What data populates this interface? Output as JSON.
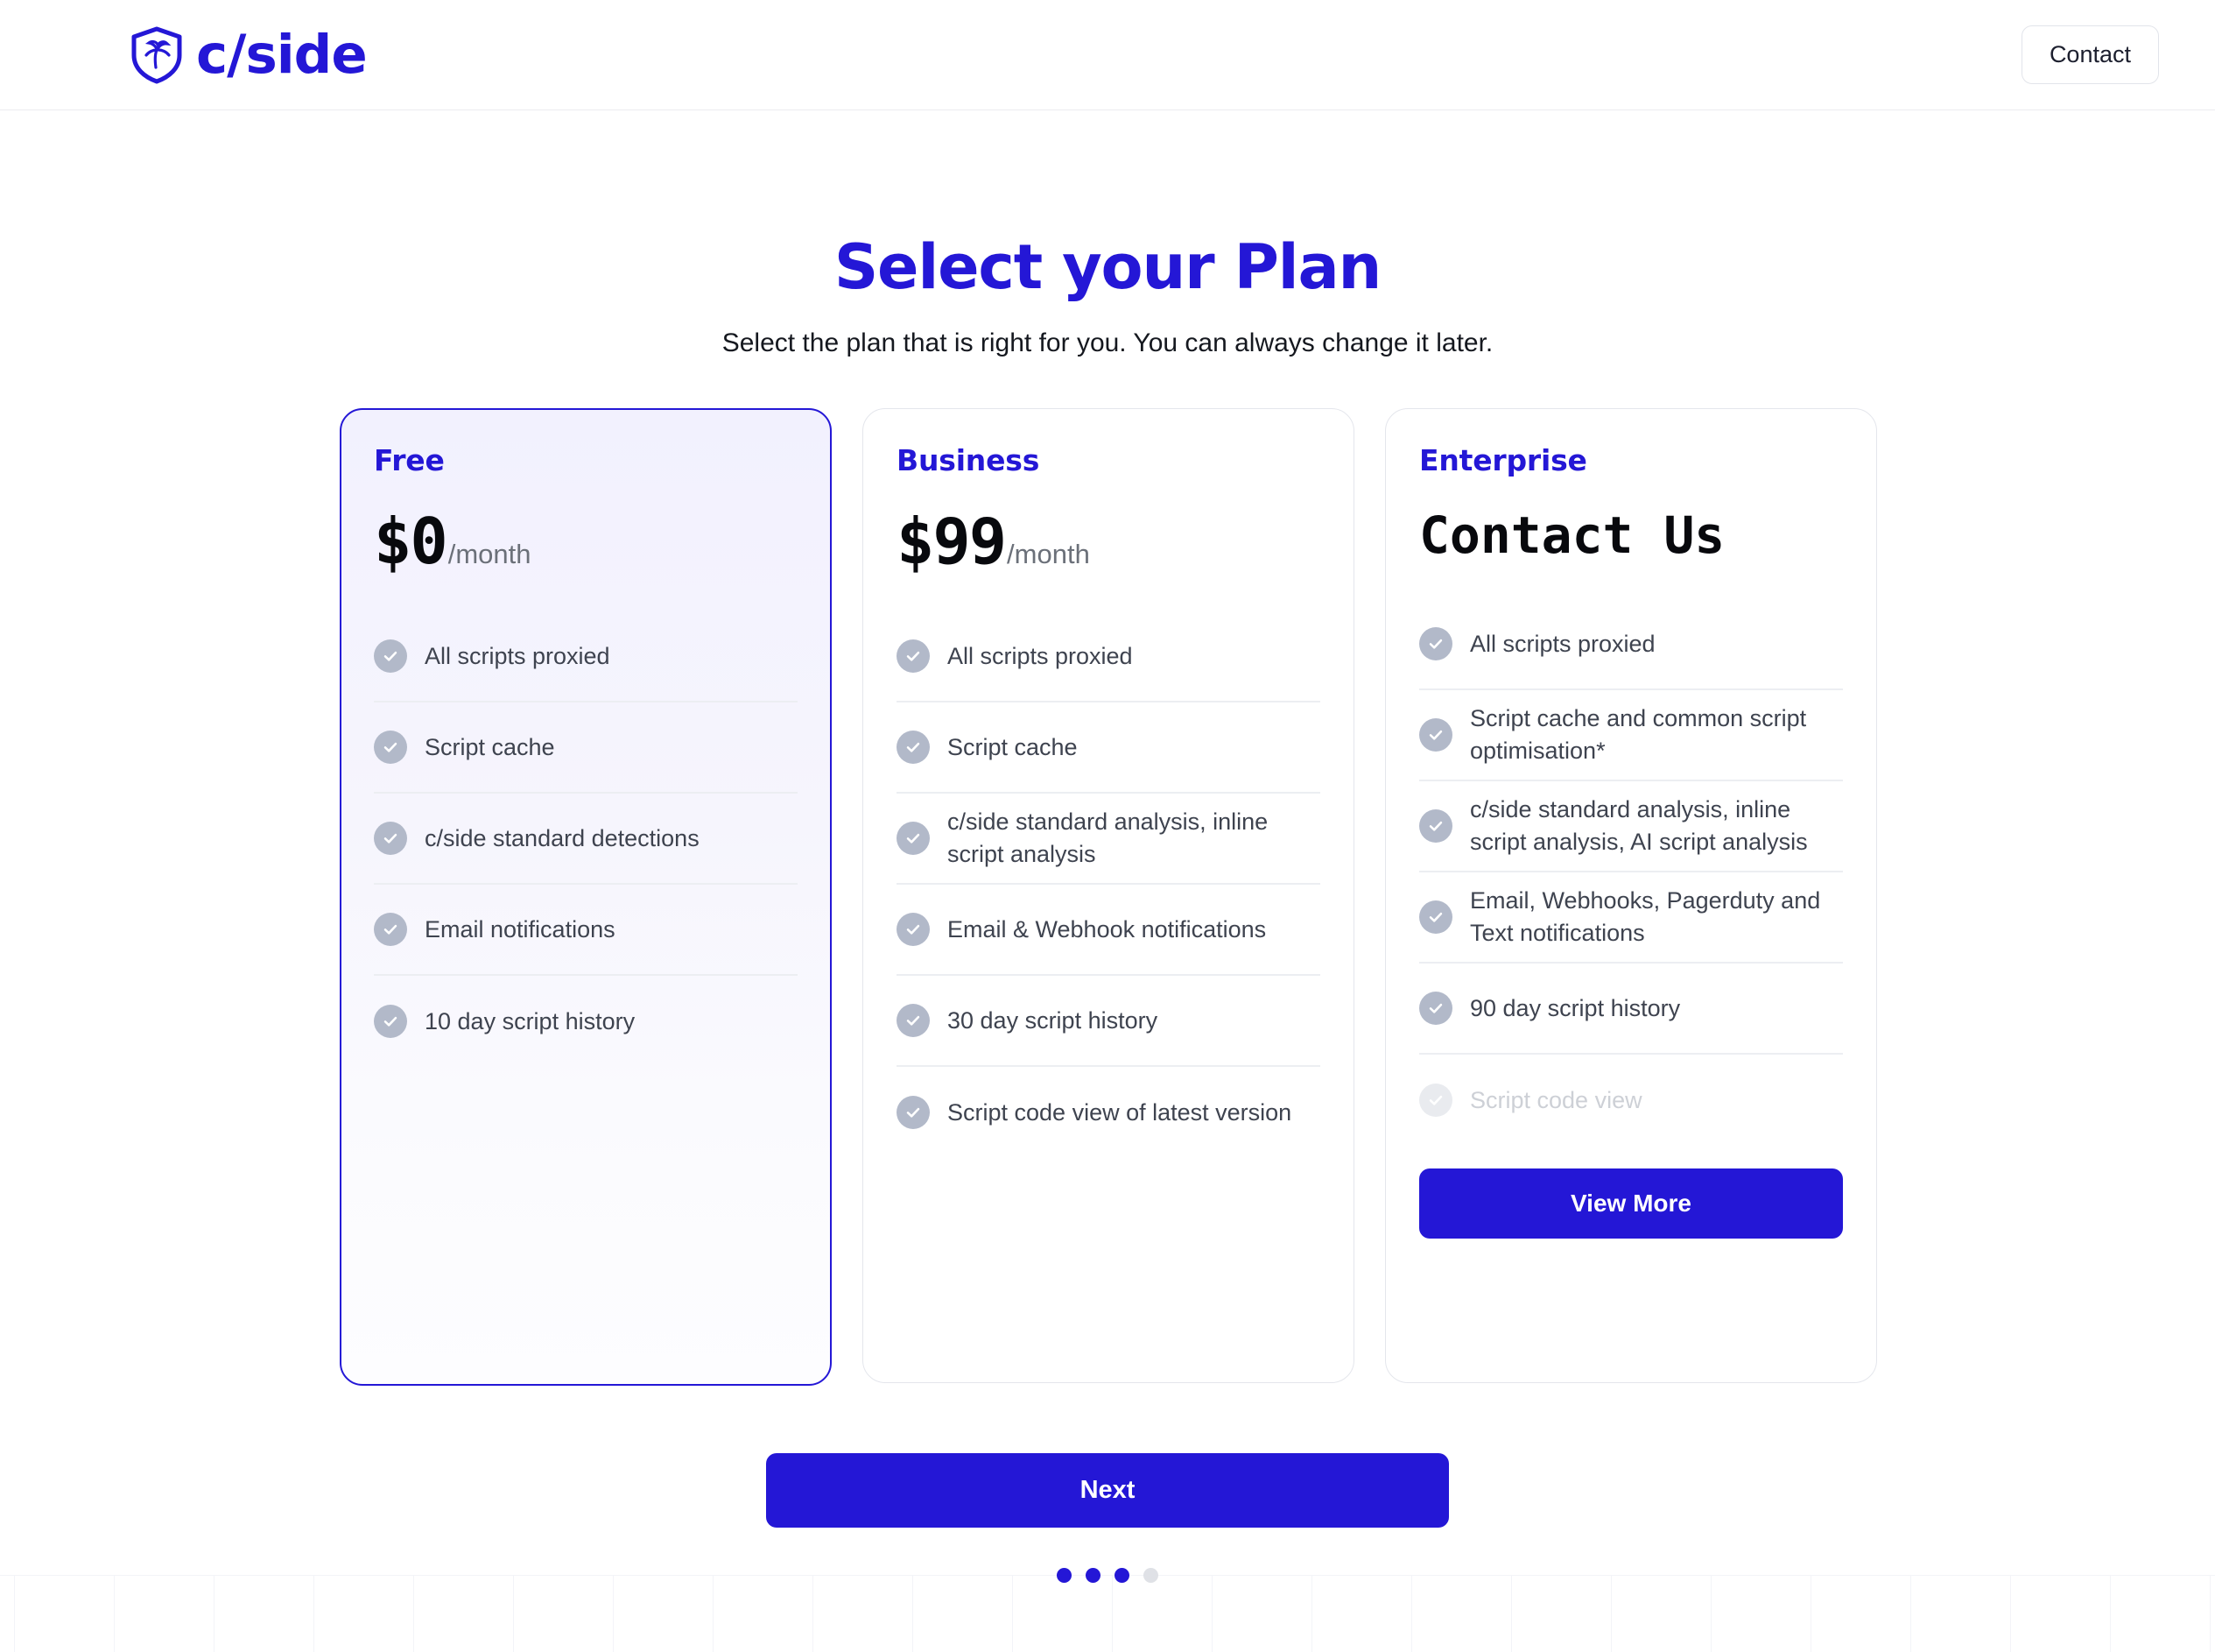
{
  "header": {
    "logo_text": "c/side",
    "logo_icon": "shield-palm-icon",
    "contact_label": "Contact"
  },
  "hero": {
    "title": "Select your Plan",
    "subtitle": "Select the plan that is right for you. You can always change it later."
  },
  "colors": {
    "brand": "#2417d6",
    "check": "#b2b9c9",
    "muted_text": "#6b7079",
    "feature_text": "#3e434f",
    "faded_text": "#cdd0d6"
  },
  "plans": [
    {
      "name": "Free",
      "price_amount": "$0",
      "price_period": "/month",
      "selected": true,
      "features": [
        {
          "label": "All scripts proxied",
          "faded": false
        },
        {
          "label": "Script cache",
          "faded": false
        },
        {
          "label": "c/side standard detections",
          "faded": false
        },
        {
          "label": "Email notifications",
          "faded": false
        },
        {
          "label": "10 day script history",
          "faded": false
        }
      ],
      "cta": null
    },
    {
      "name": "Business",
      "price_amount": "$99",
      "price_period": "/month",
      "selected": false,
      "features": [
        {
          "label": "All scripts proxied",
          "faded": false
        },
        {
          "label": "Script cache",
          "faded": false
        },
        {
          "label": "c/side standard analysis, inline script analysis",
          "faded": false
        },
        {
          "label": "Email & Webhook notifications",
          "faded": false
        },
        {
          "label": "30 day script history",
          "faded": false
        },
        {
          "label": "Script code view of latest version",
          "faded": false
        }
      ],
      "cta": null
    },
    {
      "name": "Enterprise",
      "price_amount": "Contact Us",
      "price_period": "",
      "selected": false,
      "features": [
        {
          "label": "All scripts proxied",
          "faded": false
        },
        {
          "label": "Script cache and common script optimisation*",
          "faded": false
        },
        {
          "label": "c/side standard analysis, inline script analysis, AI script analysis",
          "faded": false
        },
        {
          "label": "Email, Webhooks, Pagerduty and Text notifications",
          "faded": false
        },
        {
          "label": "90 day script history",
          "faded": false
        },
        {
          "label": "Script code view",
          "faded": true
        }
      ],
      "cta": "View More"
    }
  ],
  "footer": {
    "next_label": "Next",
    "pagination": {
      "total": 4,
      "active": 3
    }
  }
}
